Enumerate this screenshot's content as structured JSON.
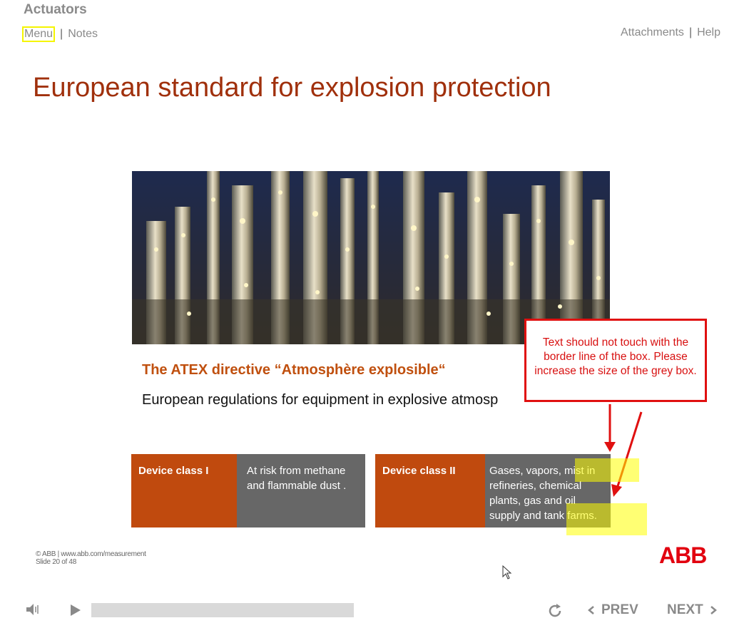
{
  "app": {
    "title": "Actuators"
  },
  "topnav": {
    "menu": "Menu",
    "notes": "Notes",
    "attachments": "Attachments",
    "help": "Help",
    "separator": "|"
  },
  "slide": {
    "title": "European standard for explosion protection",
    "subhead": "The ATEX directive “Atmosphère explosible“",
    "body": "European regulations for equipment in explosive atmosp",
    "cards": [
      {
        "label": "Device class I",
        "description_lines": [
          "At risk from methane",
          "and flammable dust ."
        ]
      },
      {
        "label": "Device class II",
        "description_lines": [
          "Gases, vapors, mist in",
          "refineries, chemical",
          "plants, gas and oil",
          "supply and tank farms."
        ]
      }
    ],
    "callout": "Text should not touch with the border line of the box. Please increase the size of the grey box.",
    "footer": {
      "copyright": "© ABB | www.abb.com/measurement",
      "slide_counter": "Slide 20 of 48"
    },
    "logo": "ABB"
  },
  "player": {
    "prev": "PREV",
    "next": "NEXT",
    "progress": 0.0
  },
  "colors": {
    "accent_red": "#e01010",
    "title_rust": "#a0300c",
    "card_orange": "#c04a0e",
    "card_grey": "#676767",
    "highlight": "#ffff00"
  }
}
